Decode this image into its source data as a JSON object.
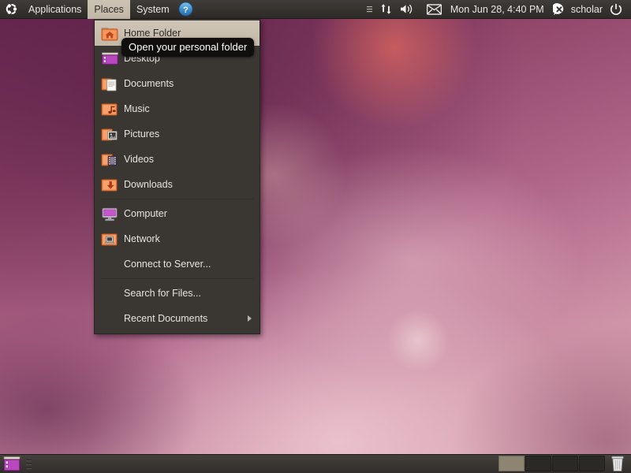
{
  "desktop": {
    "environment": "GNOME",
    "wallpaper_colors": [
      "#6d2a52",
      "#8e4367",
      "#b0678a",
      "#cf94a8",
      "#d9a3b2"
    ]
  },
  "top_panel": {
    "logo": "ubuntu-logo",
    "menus": [
      {
        "label": "Applications",
        "name": "menu-applications",
        "active": false
      },
      {
        "label": "Places",
        "name": "menu-places",
        "active": true
      },
      {
        "label": "System",
        "name": "menu-system",
        "active": false
      }
    ],
    "help_icon": "help-icon",
    "help_label": "?",
    "tray": {
      "indicator_icon": "indicator-menu-icon",
      "network_icon": "network-transfer-icon",
      "volume_icon": "volume-icon",
      "messaging_icon": "envelope-icon",
      "clock": "Mon Jun 28,  4:40 PM",
      "status_icon": "user-status-offline-icon",
      "username": "scholar",
      "power_icon": "power-icon"
    }
  },
  "places_menu": {
    "items": [
      {
        "label": "Home Folder",
        "icon": "folder-home-icon",
        "name": "places-item-home-folder",
        "selected": true,
        "separator_after": false,
        "submenu": false
      },
      {
        "label": "Desktop",
        "icon": "desktop-icon",
        "name": "places-item-desktop",
        "selected": false,
        "separator_after": false,
        "submenu": false
      },
      {
        "label": "Documents",
        "icon": "folder-documents-icon",
        "name": "places-item-documents",
        "selected": false,
        "separator_after": false,
        "submenu": false
      },
      {
        "label": "Music",
        "icon": "folder-music-icon",
        "name": "places-item-music",
        "selected": false,
        "separator_after": false,
        "submenu": false
      },
      {
        "label": "Pictures",
        "icon": "folder-pictures-icon",
        "name": "places-item-pictures",
        "selected": false,
        "separator_after": false,
        "submenu": false
      },
      {
        "label": "Videos",
        "icon": "folder-videos-icon",
        "name": "places-item-videos",
        "selected": false,
        "separator_after": false,
        "submenu": false
      },
      {
        "label": "Downloads",
        "icon": "folder-downloads-icon",
        "name": "places-item-downloads",
        "selected": false,
        "separator_after": true,
        "submenu": false
      },
      {
        "label": "Computer",
        "icon": "computer-icon",
        "name": "places-item-computer",
        "selected": false,
        "separator_after": false,
        "submenu": false
      },
      {
        "label": "Network",
        "icon": "folder-network-icon",
        "name": "places-item-network",
        "selected": false,
        "separator_after": false,
        "submenu": false
      },
      {
        "label": "Connect to Server...",
        "icon": null,
        "name": "places-item-connect-to-server",
        "selected": false,
        "separator_after": true,
        "submenu": false
      },
      {
        "label": "Search for Files...",
        "icon": null,
        "name": "places-item-search-for-files",
        "selected": false,
        "separator_after": false,
        "submenu": false
      },
      {
        "label": "Recent Documents",
        "icon": null,
        "name": "places-item-recent-documents",
        "selected": false,
        "separator_after": false,
        "submenu": true
      }
    ]
  },
  "tooltip": {
    "text": "Open your personal folder"
  },
  "bottom_panel": {
    "show_desktop_icon": "show-desktop-icon",
    "workspaces": [
      {
        "name": "workspace-1",
        "active": true
      },
      {
        "name": "workspace-2",
        "active": false
      },
      {
        "name": "workspace-3",
        "active": false
      },
      {
        "name": "workspace-4",
        "active": false
      }
    ],
    "trash_icon": "trash-icon"
  }
}
